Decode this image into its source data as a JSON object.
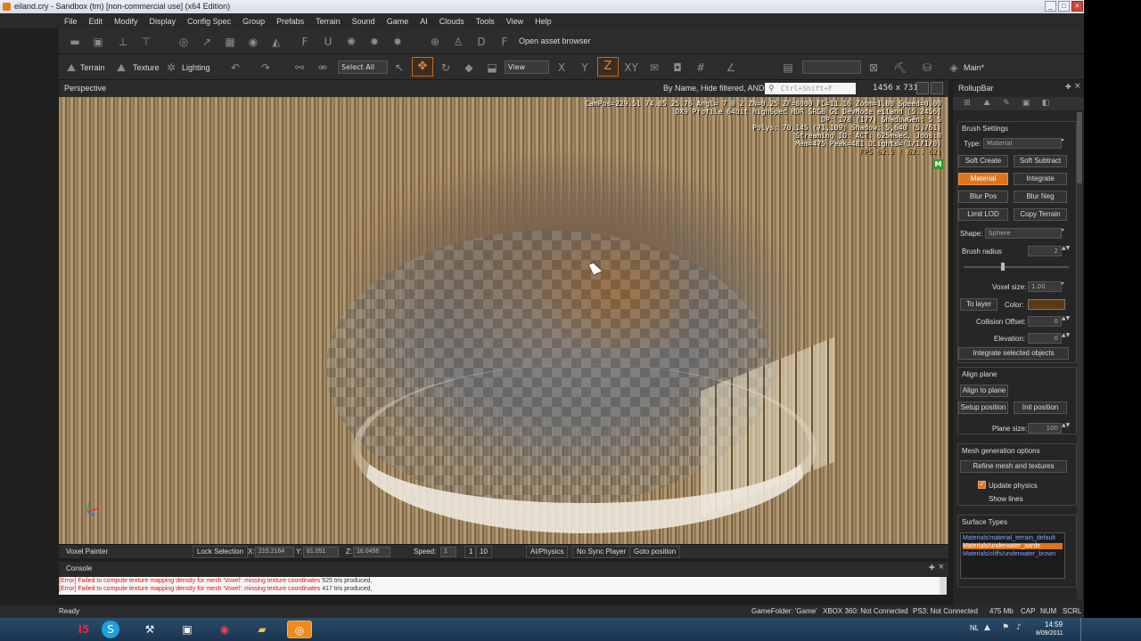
{
  "window": {
    "title": "eiland.cry - Sandbox (tm) [non-commercial use] (x64 Edition)"
  },
  "menu": [
    "File",
    "Edit",
    "Modify",
    "Display",
    "Config Spec",
    "Group",
    "Prefabs",
    "Terrain",
    "Sound",
    "Game",
    "AI",
    "Clouds",
    "Tools",
    "View",
    "Help"
  ],
  "toolbar1": {
    "asset_browser": "Open asset browser"
  },
  "toolbar2": {
    "terrain": "Terrain",
    "texture": "Texture",
    "lighting": "Lighting",
    "select_all": "Select All",
    "view": "View",
    "main": "Main*"
  },
  "viewport": {
    "title": "Perspective",
    "filter": "By Name, Hide filtered, AND",
    "search_placeholder": "Ctrl+Shift+F",
    "resolution": "1456 x 731",
    "stats": [
      "CamPos=229.51 74.05 25.76 Angl=  7  0  2 ZN=0.25 ZF=8000 FC=11.16 Zoom=1.00 Speed=0.00",
      "DX9 Profile 64bit HighSpec HDR SRGB GI DevMode eiland [5.2456]",
      "DP: 178 (177) ShadowGen: 5 5",
      "Polys: 70,145 (71,109) Shadow: 5,640 (5,761)",
      "Streaming IO: ACT: 625msec, Jobs:0",
      "Mem=475 Peak=481 DLights=(1/1/1/0)"
    ],
    "fps": "FPS 62.5 ( 62.. 62)",
    "mode_badge": "M"
  },
  "vpstatus": {
    "tool": "Voxel Painter",
    "lock": "Lock Selection",
    "x_label": "X:",
    "x": "215.2164",
    "y_label": "Y:",
    "y": "81.051",
    "z_label": "Z:",
    "z": "16.0456",
    "speed_label": "Speed:",
    "speed": "1",
    "speed_1": "1",
    "speed_10": "10",
    "ai_physics": "AI/Physics",
    "no_sync": "No Sync Player",
    "goto": "Goto position"
  },
  "console": {
    "title": "Console",
    "lines": [
      {
        "error": "[Error] Failed to compute texture mapping density for mesh 'Voxel': missing texture coordinates",
        "info": "525 tris produced,"
      },
      {
        "error": "[Error] Failed to compute texture mapping density for mesh 'Voxel': missing texture coordinates",
        "info": "417 tris produced,"
      }
    ]
  },
  "statusbar": {
    "ready": "Ready",
    "game_folder": "GameFolder: 'Game'",
    "xbox": "XBOX 360: Not Connected",
    "ps3": "PS3: Not Connected",
    "memory": "475 Mb",
    "cap": "CAP",
    "num": "NUM",
    "scrl": "SCRL"
  },
  "taskbar": {
    "lang": "NL",
    "time": "14:59",
    "date": "8/09/2011"
  },
  "rollup": {
    "title": "RollupBar",
    "brush_settings": "Brush Settings",
    "type_label": "Type:",
    "type_value": "Material",
    "buttons": {
      "soft_create": "Soft Create",
      "soft_subtract": "Soft Subtract",
      "material": "Material",
      "integrate": "Integrate",
      "blur_pos": "Blur Pos",
      "blur_neg": "Blur Neg",
      "limit_lod": "Limit LOD",
      "copy_terrain": "Copy Terrain"
    },
    "shape_label": "Shape:",
    "shape_value": "Sphere",
    "brush_radius_label": "Brush radius",
    "brush_radius": "2",
    "voxel_size_label": "Voxel size:",
    "voxel_size": "1.00",
    "to_layer": "To layer",
    "color_label": "Color:",
    "color_value": "#5b3a14",
    "collision_offset_label": "Collision Offset:",
    "collision_offset": "0",
    "elevation_label": "Elevation:",
    "elevation": "0",
    "integrate_selected": "Integrate selected objects",
    "align_plane": "Align plane",
    "align_to_plane": "Align to plane",
    "setup_position": "Setup position",
    "init_position": "Init position",
    "plane_size_label": "Plane size:",
    "plane_size": "100",
    "mesh_gen": "Mesh generation options",
    "refine": "Refine mesh and textures",
    "update_physics": "Update physics",
    "show_lines": "Show lines",
    "surface_types": "Surface Types",
    "surfaces": [
      "Materials/material_terrain_default",
      "Materials/underwater_aarde",
      "Materials/cliffs/underwater_brown"
    ],
    "accent": "#e0741c"
  }
}
